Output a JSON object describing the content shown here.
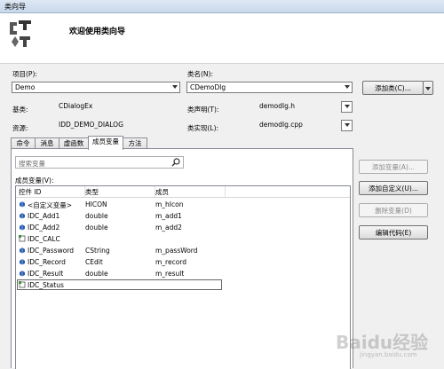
{
  "window": {
    "title": "类向导"
  },
  "header": {
    "welcome": "欢迎使用类向导"
  },
  "project": {
    "label": "项目(P):",
    "value": "Demo"
  },
  "classname": {
    "label": "类名(N):",
    "value": "CDemoDlg"
  },
  "add_class_button": "添加类(C)...",
  "base": {
    "label": "基类:",
    "value": "CDialogEx"
  },
  "declaration": {
    "label": "类声明(T):",
    "value": "demodlg.h"
  },
  "resource": {
    "label": "资源:",
    "value": "IDD_DEMO_DIALOG"
  },
  "implementation": {
    "label": "类实现(L):",
    "value": "demodlg.cpp"
  },
  "tabs": [
    "命令",
    "消息",
    "虚函数",
    "成员变量",
    "方法"
  ],
  "active_tab": "成员变量",
  "search": {
    "placeholder": "搜索变量"
  },
  "member_list": {
    "label": "成员变量(V):",
    "columns": [
      "控件 ID",
      "类型",
      "成员"
    ],
    "rows": [
      {
        "id": "<自定义变量>",
        "type": "HICON",
        "member": "m_hIcon",
        "icon": "variable-icon"
      },
      {
        "id": "IDC_Add1",
        "type": "double",
        "member": "m_add1",
        "icon": "variable-icon"
      },
      {
        "id": "IDC_Add2",
        "type": "double",
        "member": "m_add2",
        "icon": "variable-icon"
      },
      {
        "id": "IDC_CALC",
        "type": "",
        "member": "",
        "icon": "control-icon"
      },
      {
        "id": "IDC_Password",
        "type": "CString",
        "member": "m_passWord",
        "icon": "variable-icon"
      },
      {
        "id": "IDC_Record",
        "type": "CEdit",
        "member": "m_record",
        "icon": "variable-icon"
      },
      {
        "id": "IDC_Result",
        "type": "double",
        "member": "m_result",
        "icon": "variable-icon"
      },
      {
        "id": "IDC_Status",
        "type": "",
        "member": "",
        "icon": "control-icon",
        "selected": true
      }
    ]
  },
  "buttons": {
    "add_variable": "添加变量(A)...",
    "add_custom": "添加自定义(U)...",
    "delete_variable": "删除变量(D)",
    "edit_code": "编辑代码(E)"
  },
  "watermark": {
    "main": "Baidu经验",
    "sub": "jingyan.baidu.com"
  },
  "colors": {
    "variable_icon": "#2a5db0",
    "control_icon": "#3f8f3f"
  }
}
